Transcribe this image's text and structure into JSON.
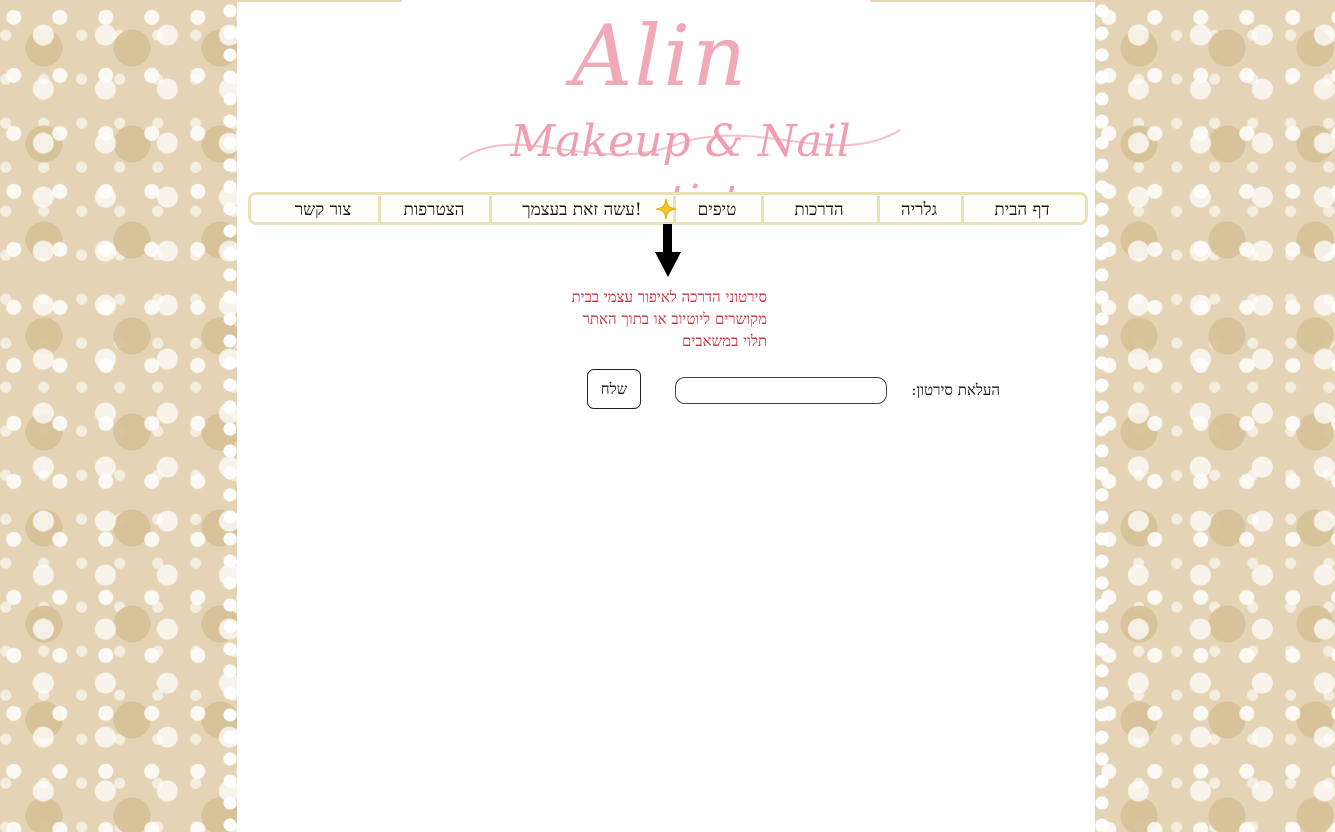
{
  "logo": {
    "title": "Alin",
    "subtitle": "Makeup & Nail artist"
  },
  "nav": {
    "items": [
      {
        "label": "דף הבית"
      },
      {
        "label": "גלריה"
      },
      {
        "label": "הדרכות"
      },
      {
        "label": "טיפים"
      },
      {
        "label": "עשה זאת בעצמך!"
      },
      {
        "label": "הצטרפות"
      },
      {
        "label": "צור קשר"
      }
    ]
  },
  "note": {
    "lines": [
      "סירטוני הדרכה לאיפור עצמי בבית",
      "מקושרים ליוטיוב או בתוך האתר",
      "תלוי במשאבים"
    ]
  },
  "upload": {
    "label": "העלאת סירטון:",
    "input_value": "",
    "send_label": "שלח"
  },
  "colors": {
    "logo_pink": "#f0a9b6",
    "note_red": "#c8323d",
    "lace_beige": "#e4d4b5",
    "nav_border": "#e9e1b7",
    "star_yellow": "#f5c928"
  },
  "icons": {
    "star": "star-sparkle-icon",
    "arrow": "arrow-down-icon"
  }
}
